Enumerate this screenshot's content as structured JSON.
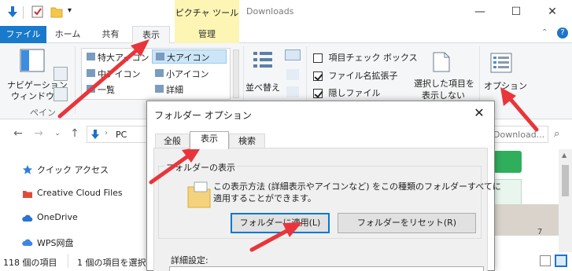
{
  "window": {
    "title": "Downloads",
    "picture_tools": "ピクチャ ツール",
    "controls": [
      "minimize",
      "maximize",
      "close"
    ]
  },
  "ribbon_tabs": {
    "file": "ファイル",
    "home": "ホーム",
    "share": "共有",
    "view": "表示",
    "manage": "管理"
  },
  "ribbon": {
    "pane_group": {
      "nav_pane_label_line1": "ナビゲーション",
      "nav_pane_label_line2": "ウィンドウ",
      "group_name": "ペイン"
    },
    "layout": {
      "xl_icons": "特大アイコン",
      "large_icons": "大アイコン",
      "medium_icons": "中アイコン",
      "small_icons": "小アイコン",
      "list": "一覧",
      "details": "詳細"
    },
    "sort": {
      "label": "並べ替え"
    },
    "show_hide": {
      "item_checkboxes": "項目チェック ボックス",
      "item_checkboxes_checked": false,
      "file_extensions": "ファイル名拡張子",
      "file_extensions_checked": true,
      "hidden_items": "隠しファイル",
      "hidden_items_checked": true,
      "hide_selected_line1": "選択した項目を",
      "hide_selected_line2": "表示しない"
    },
    "options": {
      "label": "オプション"
    }
  },
  "address": {
    "path": "PC",
    "search_placeholder": "Download..."
  },
  "nav_pane": {
    "items": [
      {
        "label": "クイック アクセス",
        "icon": "star-icon"
      },
      {
        "label": "Creative Cloud Files",
        "icon": "folder-icon"
      },
      {
        "label": "OneDrive",
        "icon": "cloud-icon"
      },
      {
        "label": "WPS网盘",
        "icon": "cloud-icon"
      }
    ]
  },
  "status": {
    "count": "118 個の項目",
    "selected": "1 個の項目を選択"
  },
  "dialog": {
    "title": "フォルダー オプション",
    "tabs": [
      "全般",
      "表示",
      "検索"
    ],
    "active_tab": "表示",
    "fieldset_label": "フォルダーの表示",
    "description_line1": "この表示方法 (詳細表示やアイコンなど) をこの種類のフォルダーすべてに",
    "description_line2": "適用することができます。",
    "apply_button": "フォルダーに適用(L)",
    "reset_button": "フォルダーをリセット(R)",
    "advanced_label": "詳細設定:"
  },
  "colors": {
    "accent": "#1979ca",
    "picture_tools_bg": "#fdf5b4",
    "annotation_arrow": "#e8353b",
    "focus_border": "#0078d7"
  }
}
